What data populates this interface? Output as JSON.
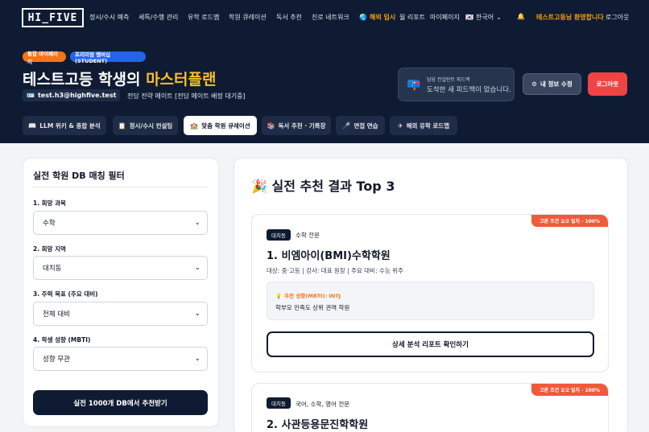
{
  "nav": {
    "logo": "HI_FIVE",
    "items": [
      {
        "label": "정시/수시 예측"
      },
      {
        "label": "세특/수행 관리"
      },
      {
        "label": "유학 로드맵"
      },
      {
        "label": "학원 큐레이션"
      },
      {
        "label": "독서 추천"
      },
      {
        "label": "진로 네트워크"
      }
    ],
    "overseas": "해외 입시",
    "weekly_report": "월 리포트",
    "mypage": "마이페이지",
    "language": "한국어",
    "welcome": "테스트고등님 환영합니다",
    "logout": "로그아웃"
  },
  "hero": {
    "badge_integrated": "통합 마이페이지",
    "badge_premium": "프리미엄 멤버십 (STUDENT)",
    "title_prefix": "테스트고등 학생의 ",
    "title_highlight": "마스터플랜",
    "email": "test.h3@highfive.test",
    "role": "전담 전략 메이트 [전담 메이트 배정 대기중]",
    "feedback_label": "담당 컨설턴트 피드백",
    "feedback_message": "도착한 새 피드백이 없습니다.",
    "edit_button": "내 정보 수정",
    "logout_button": "로그아웃"
  },
  "tabs": [
    {
      "label": "LLM 위키 & 종합 분석"
    },
    {
      "label": "정시/수시 컨설팅"
    },
    {
      "label": "맞춤 학원 큐레이션"
    },
    {
      "label": "독서 추천 · 기록장"
    },
    {
      "label": "면접 연습"
    },
    {
      "label": "해외 유학 로드맵"
    }
  ],
  "filter": {
    "title": "실전 학원 DB 매칭 필터",
    "fields": [
      {
        "label": "1. 희망 과목",
        "value": "수학"
      },
      {
        "label": "2. 희망 지역",
        "value": "대치동"
      },
      {
        "label": "3. 주력 목표 (주요 대비)",
        "value": "전체 대비"
      },
      {
        "label": "4. 학생 성향 (MBTI)",
        "value": "성향 무관"
      }
    ],
    "submit": "실전 1000개 DB에서 추천받기"
  },
  "results": {
    "title": "실전 추천 결과 Top 3",
    "cards": [
      {
        "ribbon": "고른 조건 2/2 일치 · 100%",
        "region": "대치동",
        "specialty": "수학 전문",
        "name": "1. 비엠아이(BMI)수학학원",
        "meta": "대상: 중·고등 | 강사: 대표 원장 | 주요 대비: 수능 위주",
        "mbti_label": "추천 성향(MBTI): INTJ",
        "mbti_desc": "학부모 만족도 상위 권역 학원",
        "detail_button": "상세 분석 리포트 확인하기"
      },
      {
        "ribbon": "고른 조건 2/2 일치 · 100%",
        "region": "대치동",
        "specialty": "국어, 수학, 영어 전문",
        "name": "2. 사관등용문진학학원"
      }
    ]
  }
}
